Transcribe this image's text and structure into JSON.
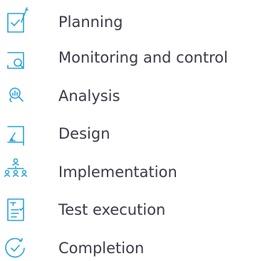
{
  "accent_color": "#2aa3d6",
  "text_color": "#3b3b4a",
  "items": [
    {
      "label": "Planning",
      "icon": "checklist-pen-icon"
    },
    {
      "label": "Monitoring and control",
      "icon": "document-magnifier-icon"
    },
    {
      "label": "Analysis",
      "icon": "chart-magnifier-icon"
    },
    {
      "label": "Design",
      "icon": "pen-on-frame-icon"
    },
    {
      "label": "Implementation",
      "icon": "team-hierarchy-icon"
    },
    {
      "label": "Test execution",
      "icon": "test-checklist-icon"
    },
    {
      "label": "Completion",
      "icon": "circular-check-icon"
    }
  ]
}
